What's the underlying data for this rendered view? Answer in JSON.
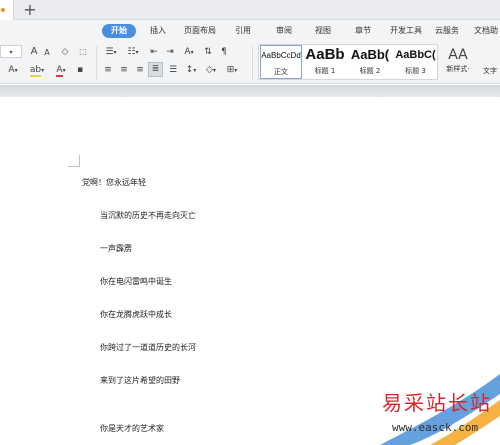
{
  "tabbar": {
    "new_tab_glyph": "+"
  },
  "menu": {
    "items": [
      "开始",
      "插入",
      "页面布局",
      "引用",
      "审阅",
      "视图",
      "章节",
      "开发工具",
      "云服务",
      "文档助"
    ]
  },
  "toolbar": {
    "font_size_down": "A⁻",
    "font_grow": "A",
    "font_shrink": "A",
    "clear_format": "◇",
    "char_border": "wén",
    "text_effect": "A",
    "highlight": "ab",
    "font_color": "A",
    "list_bullets": "☰",
    "list_numbers": "☷",
    "indent_dec": "⇤",
    "indent_inc": "⇥",
    "sort_a": "A",
    "para_mark": "¶",
    "shading": "◇",
    "borders": "⊞"
  },
  "styles": {
    "items": [
      {
        "preview": "AaBbCcDd",
        "name": "正文"
      },
      {
        "preview": "AaBb",
        "name": "标题 1"
      },
      {
        "preview": "AaBb(",
        "name": "标题 2"
      },
      {
        "preview": "AaBbC(",
        "name": "标题 3"
      }
    ],
    "new_style_label": "新样式·",
    "new_style_glyph": "AA",
    "text_tools_label": "文字"
  },
  "document": {
    "lines": [
      "党啊！您永远年轻",
      "当沉默的历史不再走向灭亡",
      "一声霹雳",
      "你在电闪雷鸣中诞生",
      "你在龙腾虎跃中成长",
      "你跨过了一道道历史的长河",
      "来到了这片希望的田野",
      "你是天才的艺术家"
    ]
  },
  "watermark": {
    "title": "易采站长站",
    "url": "www.easck.com"
  }
}
